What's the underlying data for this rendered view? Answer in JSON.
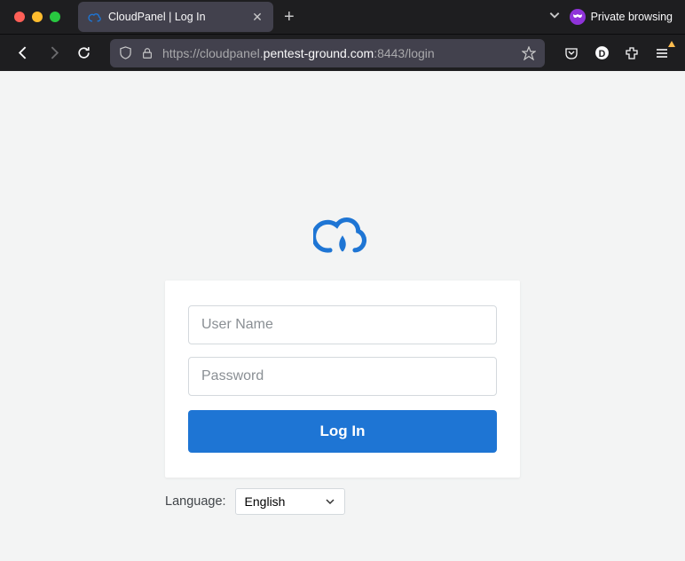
{
  "tab": {
    "title": "CloudPanel | Log In"
  },
  "private_browsing_label": "Private browsing",
  "url": {
    "scheme": "https://",
    "sub": "cloudpanel.",
    "domain": "pentest-ground.com",
    "port_path": ":8443/login"
  },
  "login": {
    "username_placeholder": "User Name",
    "password_placeholder": "Password",
    "button_label": "Log In"
  },
  "language": {
    "label": "Language:",
    "selected": "English"
  }
}
